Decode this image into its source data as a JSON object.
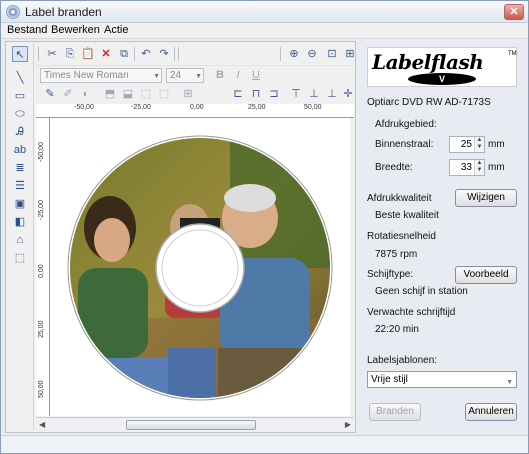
{
  "window": {
    "title": "Label branden",
    "close": "✕"
  },
  "menu": [
    {
      "label": "Bestand",
      "underline": "B"
    },
    {
      "label": "Bewerken",
      "underline": "w"
    },
    {
      "label": "Actie",
      "underline": "A"
    }
  ],
  "toolbar": {
    "font_name": "Times New Roman",
    "font_size": "24"
  },
  "ruler": {
    "h_labels": [
      "-50,00",
      "-25,00",
      "0,00",
      "25,00",
      "50,00"
    ],
    "v_labels": [
      "-50,00",
      "-25,00",
      "0,00",
      "25,00",
      "50,00"
    ]
  },
  "panel": {
    "logo_text": "Labelflash",
    "logo_tm": "TM",
    "logo_v": "V",
    "drive": "Optiarc DVD RW AD-7173S",
    "print_area_heading": "Afdrukgebied:",
    "inner_label": "Binnenstraal:",
    "inner_value": "25",
    "inner_unit": "mm",
    "width_label": "Breedte:",
    "width_value": "33",
    "width_unit": "mm",
    "quality_label": "Afdrukkwaliteit",
    "quality_button": "Wijzigen",
    "quality_value": "Beste kwaliteit",
    "rotation_label": "Rotatiesnelheid",
    "rotation_value": "7875 rpm",
    "disc_type_label": "Schijftype:",
    "preview_button": "Voorbeeld",
    "disc_type_value": "Geen schijf in station",
    "write_time_label": "Verwachte schrijftijd",
    "write_time_value": "22:20 min",
    "templates_label": "Labelsjablonen:",
    "templates_value": "Vrije stijl",
    "burn_button": "Branden",
    "cancel_button": "Annuleren"
  },
  "colors": {
    "accent": "#2d4f8a",
    "close": "#c9584a",
    "window_bg": "#e8ecf2"
  }
}
